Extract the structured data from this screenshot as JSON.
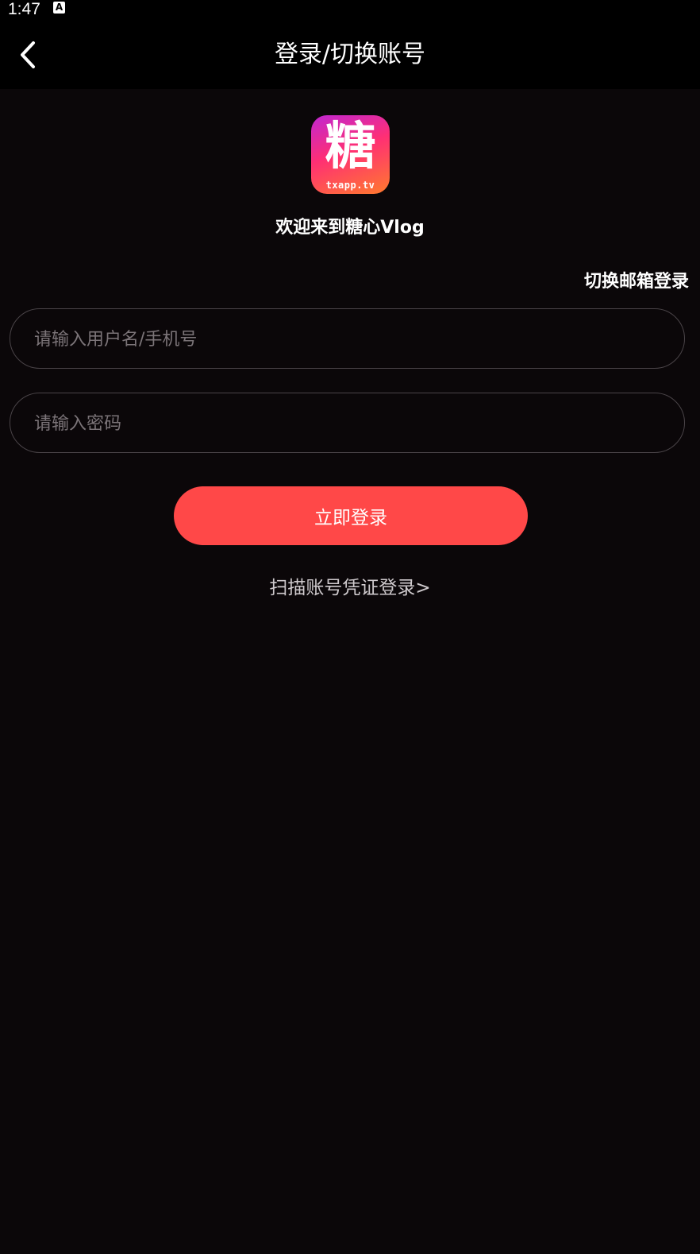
{
  "status_bar": {
    "time": "1:47",
    "notification_icon": "a-letter-icon",
    "notification_glyph": "A"
  },
  "app_bar": {
    "back_icon": "chevron-left-icon",
    "title": "登录/切换账号"
  },
  "branding": {
    "logo_glyph": "糖",
    "logo_domain": "txapp.tv",
    "welcome_text": "欢迎来到糖心Vlog"
  },
  "form": {
    "switch_mode_label": "切换邮箱登录",
    "username_placeholder": "请输入用户名/手机号",
    "username_value": "",
    "password_placeholder": "请输入密码",
    "password_value": "",
    "submit_label": "立即登录",
    "scan_login_label": "扫描账号凭证登录>"
  },
  "colors": {
    "background": "#0b0709",
    "app_bar": "#000000",
    "primary_button": "#ff4848",
    "field_border": "#4a4448",
    "placeholder": "#7b7478",
    "secondary_text": "#cfcacd"
  }
}
